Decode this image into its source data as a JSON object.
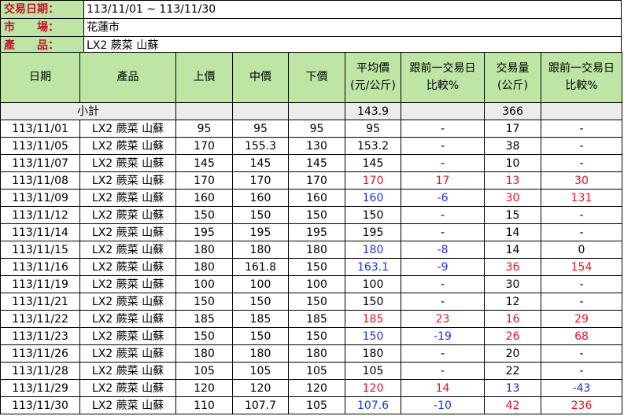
{
  "info": {
    "period_label": "交易日期：",
    "period": "113/11/01 ~ 113/11/30",
    "market_label": "市　　場：",
    "market": "花蓮市",
    "product_label": "產　　品：",
    "product": "LX2 蕨菜 山蘇"
  },
  "colors": {
    "header_bg": "#bde5a4",
    "label_text": "#c8102e",
    "subtotal_bg": "#ececec",
    "up": "#e8141e",
    "down": "#1c32e0"
  },
  "headers": {
    "date": "日期",
    "product": "產品",
    "high": "上價",
    "mid": "中價",
    "low": "下價",
    "avg_l1": "平均價",
    "avg_l2": "(元/公斤)",
    "chg_l1": "跟前一交易日",
    "chg_l2": "比較%",
    "vol_l1": "交易量",
    "vol_l2": "(公斤)",
    "vchg_l1": "跟前一交易日",
    "vchg_l2": "比較%"
  },
  "subtotal": {
    "label": "小計",
    "avg": "143.9",
    "vol": "366"
  },
  "rows": [
    {
      "date": "113/11/01",
      "product": "LX2 蕨菜 山蘇",
      "high": "95",
      "mid": "95",
      "low": "95",
      "avg": "95",
      "avg_dir": "flat",
      "chg": "-",
      "chg_dir": "flat",
      "vol": "17",
      "vol_dir": "flat",
      "vchg": "-",
      "vchg_dir": "flat"
    },
    {
      "date": "113/11/05",
      "product": "LX2 蕨菜 山蘇",
      "high": "170",
      "mid": "155.3",
      "low": "130",
      "avg": "153.2",
      "avg_dir": "flat",
      "chg": "-",
      "chg_dir": "flat",
      "vol": "38",
      "vol_dir": "flat",
      "vchg": "-",
      "vchg_dir": "flat"
    },
    {
      "date": "113/11/07",
      "product": "LX2 蕨菜 山蘇",
      "high": "145",
      "mid": "145",
      "low": "145",
      "avg": "145",
      "avg_dir": "flat",
      "chg": "-",
      "chg_dir": "flat",
      "vol": "10",
      "vol_dir": "flat",
      "vchg": "-",
      "vchg_dir": "flat"
    },
    {
      "date": "113/11/08",
      "product": "LX2 蕨菜 山蘇",
      "high": "170",
      "mid": "170",
      "low": "170",
      "avg": "170",
      "avg_dir": "up",
      "chg": "17",
      "chg_dir": "up",
      "vol": "13",
      "vol_dir": "up",
      "vchg": "30",
      "vchg_dir": "up"
    },
    {
      "date": "113/11/09",
      "product": "LX2 蕨菜 山蘇",
      "high": "160",
      "mid": "160",
      "low": "160",
      "avg": "160",
      "avg_dir": "down",
      "chg": "-6",
      "chg_dir": "down",
      "vol": "30",
      "vol_dir": "up",
      "vchg": "131",
      "vchg_dir": "up"
    },
    {
      "date": "113/11/12",
      "product": "LX2 蕨菜 山蘇",
      "high": "150",
      "mid": "150",
      "low": "150",
      "avg": "150",
      "avg_dir": "flat",
      "chg": "-",
      "chg_dir": "flat",
      "vol": "15",
      "vol_dir": "flat",
      "vchg": "-",
      "vchg_dir": "flat"
    },
    {
      "date": "113/11/14",
      "product": "LX2 蕨菜 山蘇",
      "high": "195",
      "mid": "195",
      "low": "195",
      "avg": "195",
      "avg_dir": "flat",
      "chg": "-",
      "chg_dir": "flat",
      "vol": "14",
      "vol_dir": "flat",
      "vchg": "-",
      "vchg_dir": "flat"
    },
    {
      "date": "113/11/15",
      "product": "LX2 蕨菜 山蘇",
      "high": "180",
      "mid": "180",
      "low": "180",
      "avg": "180",
      "avg_dir": "down",
      "chg": "-8",
      "chg_dir": "down",
      "vol": "14",
      "vol_dir": "flat",
      "vchg": "0",
      "vchg_dir": "flat"
    },
    {
      "date": "113/11/16",
      "product": "LX2 蕨菜 山蘇",
      "high": "180",
      "mid": "161.8",
      "low": "150",
      "avg": "163.1",
      "avg_dir": "down",
      "chg": "-9",
      "chg_dir": "down",
      "vol": "36",
      "vol_dir": "up",
      "vchg": "154",
      "vchg_dir": "up"
    },
    {
      "date": "113/11/19",
      "product": "LX2 蕨菜 山蘇",
      "high": "100",
      "mid": "100",
      "low": "100",
      "avg": "100",
      "avg_dir": "flat",
      "chg": "-",
      "chg_dir": "flat",
      "vol": "30",
      "vol_dir": "flat",
      "vchg": "-",
      "vchg_dir": "flat"
    },
    {
      "date": "113/11/21",
      "product": "LX2 蕨菜 山蘇",
      "high": "150",
      "mid": "150",
      "low": "150",
      "avg": "150",
      "avg_dir": "flat",
      "chg": "-",
      "chg_dir": "flat",
      "vol": "12",
      "vol_dir": "flat",
      "vchg": "-",
      "vchg_dir": "flat"
    },
    {
      "date": "113/11/22",
      "product": "LX2 蕨菜 山蘇",
      "high": "185",
      "mid": "185",
      "low": "185",
      "avg": "185",
      "avg_dir": "up",
      "chg": "23",
      "chg_dir": "up",
      "vol": "16",
      "vol_dir": "up",
      "vchg": "29",
      "vchg_dir": "up"
    },
    {
      "date": "113/11/23",
      "product": "LX2 蕨菜 山蘇",
      "high": "150",
      "mid": "150",
      "low": "150",
      "avg": "150",
      "avg_dir": "down",
      "chg": "-19",
      "chg_dir": "down",
      "vol": "26",
      "vol_dir": "up",
      "vchg": "68",
      "vchg_dir": "up"
    },
    {
      "date": "113/11/26",
      "product": "LX2 蕨菜 山蘇",
      "high": "180",
      "mid": "180",
      "low": "180",
      "avg": "180",
      "avg_dir": "flat",
      "chg": "-",
      "chg_dir": "flat",
      "vol": "20",
      "vol_dir": "flat",
      "vchg": "-",
      "vchg_dir": "flat"
    },
    {
      "date": "113/11/28",
      "product": "LX2 蕨菜 山蘇",
      "high": "105",
      "mid": "105",
      "low": "105",
      "avg": "105",
      "avg_dir": "flat",
      "chg": "-",
      "chg_dir": "flat",
      "vol": "22",
      "vol_dir": "flat",
      "vchg": "-",
      "vchg_dir": "flat"
    },
    {
      "date": "113/11/29",
      "product": "LX2 蕨菜 山蘇",
      "high": "120",
      "mid": "120",
      "low": "120",
      "avg": "120",
      "avg_dir": "up",
      "chg": "14",
      "chg_dir": "up",
      "vol": "13",
      "vol_dir": "down",
      "vchg": "-43",
      "vchg_dir": "down"
    },
    {
      "date": "113/11/30",
      "product": "LX2 蕨菜 山蘇",
      "high": "110",
      "mid": "107.7",
      "low": "105",
      "avg": "107.6",
      "avg_dir": "down",
      "chg": "-10",
      "chg_dir": "down",
      "vol": "42",
      "vol_dir": "up",
      "vchg": "236",
      "vchg_dir": "up"
    }
  ]
}
